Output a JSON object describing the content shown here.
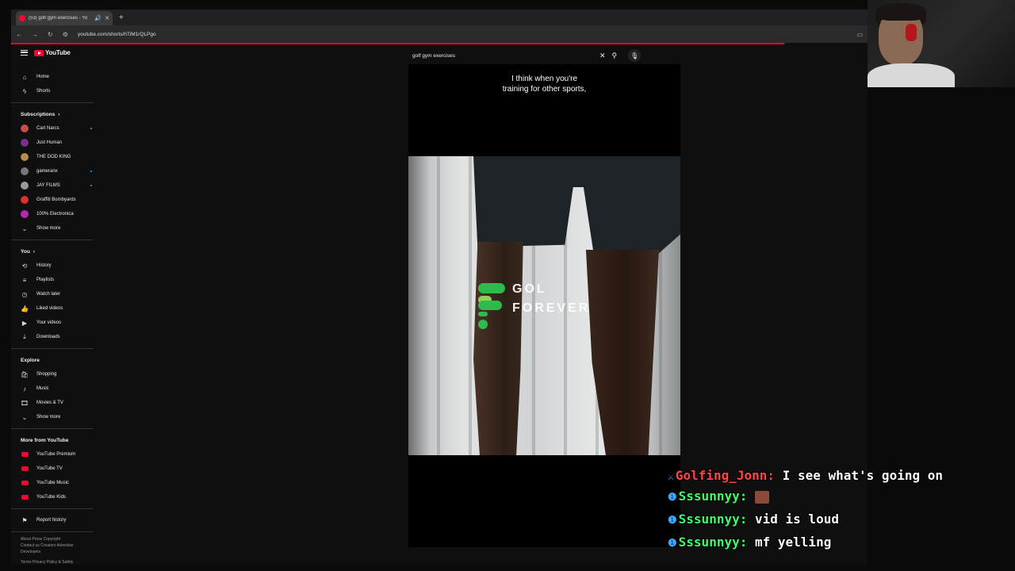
{
  "browser": {
    "tab_title": "(53) golf gym exercises - Yo",
    "url": "youtube.com/shorts/hTiM1rQLPgo"
  },
  "masthead": {
    "logo_text": "YouTube",
    "search_value": "golf gym exercises"
  },
  "sidebar": {
    "main": [
      {
        "label": "Home",
        "icon": "home-icon"
      },
      {
        "label": "Shorts",
        "icon": "shorts-icon"
      }
    ],
    "subscriptions_header": "Subscriptions",
    "subscriptions": [
      {
        "label": "Cart Narcs",
        "color": "#c94b4b",
        "dot": true
      },
      {
        "label": "Just Human",
        "color": "#7a2d8a",
        "dot": false
      },
      {
        "label": "THE DOD KING",
        "color": "#b58a4a",
        "dot": false
      },
      {
        "label": "gameranx",
        "color": "#777777",
        "dot": true
      },
      {
        "label": "JAY FILMS",
        "color": "#999999",
        "dot": true
      },
      {
        "label": "Graffiti Bombyards",
        "color": "#d8342b",
        "dot": false
      },
      {
        "label": "100% Electronica",
        "color": "#b02ab5",
        "dot": false
      }
    ],
    "subs_show_more": "Show more",
    "you_header": "You",
    "you": [
      {
        "label": "History",
        "icon": "history-icon"
      },
      {
        "label": "Playlists",
        "icon": "playlists-icon"
      },
      {
        "label": "Watch later",
        "icon": "watch-later-icon"
      },
      {
        "label": "Liked videos",
        "icon": "liked-videos-icon"
      },
      {
        "label": "Your videos",
        "icon": "your-videos-icon"
      },
      {
        "label": "Downloads",
        "icon": "downloads-icon"
      }
    ],
    "explore_header": "Explore",
    "explore": [
      {
        "label": "Shopping",
        "icon": "shopping-icon"
      },
      {
        "label": "Music",
        "icon": "music-icon"
      },
      {
        "label": "Movies & TV",
        "icon": "movies-icon"
      }
    ],
    "explore_show_more": "Show more",
    "more_header": "More from YouTube",
    "more": [
      {
        "label": "YouTube Premium"
      },
      {
        "label": "YouTube TV"
      },
      {
        "label": "YouTube Music"
      },
      {
        "label": "YouTube Kids"
      }
    ],
    "report_history": "Report history",
    "footer_line1": "About  Press  Copyright",
    "footer_line2": "Contact us  Creators  Advertise",
    "footer_line3": "Developers",
    "footer_line4": "Terms  Privacy  Policy & Safety"
  },
  "video": {
    "caption_line1": "I think when you're",
    "caption_line2": "training for other sports,",
    "logo_line1": "GOL",
    "logo_line2": "FOREVER"
  },
  "chat": [
    {
      "user": "Golfing_Jonn:",
      "message": "I see what's going on",
      "user_color": "red"
    },
    {
      "user": "Sssunnyy:",
      "message": "",
      "emote": true,
      "user_color": "green"
    },
    {
      "user": "Sssunnyy:",
      "message": "vid is loud",
      "user_color": "green"
    },
    {
      "user": "Sssunnyy:",
      "message": "mf yelling",
      "user_color": "green"
    }
  ]
}
